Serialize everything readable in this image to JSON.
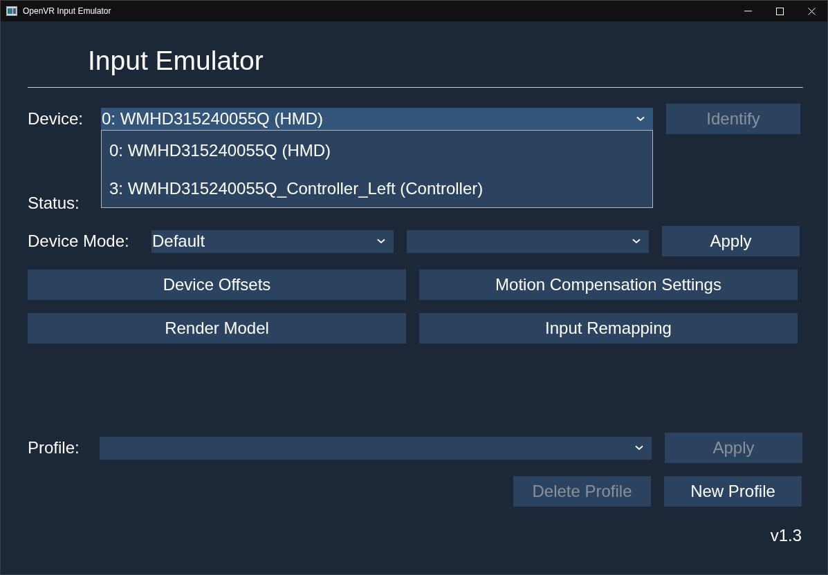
{
  "window": {
    "title": "OpenVR Input Emulator"
  },
  "heading": "Input Emulator",
  "device": {
    "label": "Device:",
    "value": "0: WMHD315240055Q (HMD)",
    "expanded": true,
    "options": [
      {
        "label": "0: WMHD315240055Q (HMD)"
      },
      {
        "label": "3: WMHD315240055Q_Controller_Left (Controller)"
      }
    ]
  },
  "identify_button": {
    "label": "Identify",
    "disabled": true
  },
  "status": {
    "label": "Status:"
  },
  "device_mode": {
    "label": "Device Mode:",
    "value": "Default"
  },
  "apply_button": {
    "label": "Apply",
    "disabled": false
  },
  "actions": [
    {
      "label": "Device Offsets",
      "disabled": false
    },
    {
      "label": "Motion Compensation Settings",
      "disabled": false
    },
    {
      "label": "Render Model",
      "disabled": false
    },
    {
      "label": "Input Remapping",
      "disabled": false
    }
  ],
  "profile": {
    "label": "Profile:"
  },
  "profile_apply_button": {
    "label": "Apply",
    "disabled": true
  },
  "profile_buttons": [
    {
      "label": "Delete Profile",
      "disabled": true
    },
    {
      "label": "New Profile",
      "disabled": false
    }
  ],
  "version": "v1.3"
}
